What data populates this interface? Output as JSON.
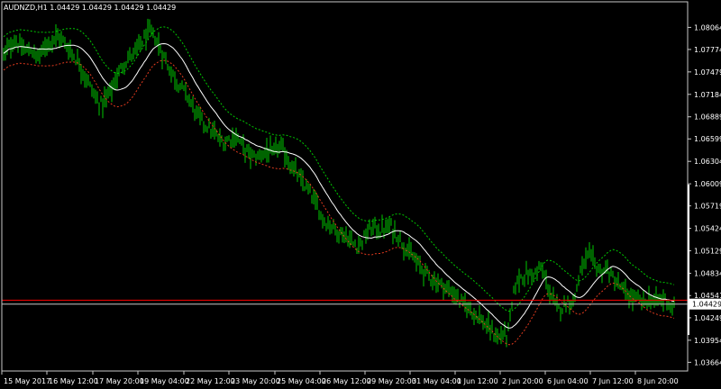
{
  "chart_data": {
    "type": "candlestick",
    "symbol_label": "AUDNZD,H1",
    "ohlc_label": "1.04429 1.04429 1.04429 1.04429",
    "current_price_label": "1.04429",
    "bid_line_price": 1.04429,
    "ask_line_price": 1.0448,
    "ylim": [
      1.0355,
      1.084
    ],
    "y_ticks": [
      "1.08064",
      "1.07774",
      "1.07479",
      "1.07184",
      "1.06889",
      "1.06599",
      "1.06304",
      "1.06009",
      "1.05719",
      "1.05424",
      "1.05129",
      "1.04834",
      "1.04541",
      "1.04249",
      "1.03954",
      "1.03664"
    ],
    "x_ticks": [
      "15 May 2017",
      "16 May 12:00",
      "17 May 20:00",
      "19 May 04:00",
      "22 May 12:00",
      "23 May 20:00",
      "25 May 04:00",
      "26 May 12:00",
      "29 May 20:00",
      "31 May 04:00",
      "1 Jun 12:00",
      "2 Jun 20:00",
      "6 Jun 04:00",
      "7 Jun 12:00",
      "8 Jun 20:00"
    ],
    "price_path": [
      [
        0,
        1.077
      ],
      [
        6,
        1.078
      ],
      [
        12,
        1.079
      ],
      [
        18,
        1.0782
      ],
      [
        24,
        1.0775
      ],
      [
        30,
        1.0778
      ],
      [
        36,
        1.0768
      ],
      [
        42,
        1.0772
      ],
      [
        48,
        1.0785
      ],
      [
        54,
        1.079
      ],
      [
        60,
        1.0795
      ],
      [
        66,
        1.0788
      ],
      [
        72,
        1.078
      ],
      [
        78,
        1.077
      ],
      [
        84,
        1.076
      ],
      [
        90,
        1.0745
      ],
      [
        96,
        1.073
      ],
      [
        102,
        1.0715
      ],
      [
        108,
        1.0705
      ],
      [
        114,
        1.0712
      ],
      [
        120,
        1.0725
      ],
      [
        126,
        1.074
      ],
      [
        132,
        1.0755
      ],
      [
        138,
        1.0765
      ],
      [
        144,
        1.077
      ],
      [
        150,
        1.078
      ],
      [
        156,
        1.079
      ],
      [
        162,
        1.08
      ],
      [
        168,
        1.0795
      ],
      [
        174,
        1.078
      ],
      [
        180,
        1.0765
      ],
      [
        186,
        1.075
      ],
      [
        192,
        1.0738
      ],
      [
        198,
        1.0728
      ],
      [
        204,
        1.0718
      ],
      [
        210,
        1.0705
      ],
      [
        216,
        1.069
      ],
      [
        222,
        1.0682
      ],
      [
        228,
        1.0675
      ],
      [
        234,
        1.0668
      ],
      [
        240,
        1.066
      ],
      [
        246,
        1.0655
      ],
      [
        252,
        1.066
      ],
      [
        258,
        1.0665
      ],
      [
        264,
        1.0655
      ],
      [
        270,
        1.0645
      ],
      [
        276,
        1.0638
      ],
      [
        282,
        1.0635
      ],
      [
        288,
        1.064
      ],
      [
        294,
        1.0645
      ],
      [
        300,
        1.0638
      ],
      [
        306,
        1.065
      ],
      [
        312,
        1.0645
      ],
      [
        318,
        1.063
      ],
      [
        324,
        1.062
      ],
      [
        330,
        1.0608
      ],
      [
        336,
        1.0598
      ],
      [
        342,
        1.0588
      ],
      [
        348,
        1.0575
      ],
      [
        354,
        1.056
      ],
      [
        360,
        1.055
      ],
      [
        366,
        1.0545
      ],
      [
        372,
        1.054
      ],
      [
        378,
        1.0535
      ],
      [
        384,
        1.053
      ],
      [
        390,
        1.0522
      ],
      [
        396,
        1.052
      ],
      [
        402,
        1.053
      ],
      [
        408,
        1.054
      ],
      [
        414,
        1.0545
      ],
      [
        420,
        1.0538
      ],
      [
        426,
        1.0542
      ],
      [
        432,
        1.0545
      ],
      [
        438,
        1.0535
      ],
      [
        444,
        1.0525
      ],
      [
        450,
        1.0515
      ],
      [
        456,
        1.0505
      ],
      [
        462,
        1.0495
      ],
      [
        468,
        1.0488
      ],
      [
        474,
        1.048
      ],
      [
        480,
        1.0475
      ],
      [
        486,
        1.047
      ],
      [
        492,
        1.0465
      ],
      [
        498,
        1.046
      ],
      [
        504,
        1.0455
      ],
      [
        510,
        1.0445
      ],
      [
        516,
        1.044
      ],
      [
        522,
        1.0435
      ],
      [
        528,
        1.043
      ],
      [
        534,
        1.042
      ],
      [
        540,
        1.0412
      ],
      [
        546,
        1.0405
      ],
      [
        552,
        1.0398
      ],
      [
        558,
        1.0405
      ],
      [
        562,
        1.04
      ],
      [
        566,
        1.043
      ],
      [
        570,
        1.0465
      ],
      [
        576,
        1.0478
      ],
      [
        582,
        1.0482
      ],
      [
        588,
        1.048
      ],
      [
        594,
        1.0485
      ],
      [
        600,
        1.049
      ],
      [
        606,
        1.047
      ],
      [
        612,
        1.045
      ],
      [
        618,
        1.0435
      ],
      [
        624,
        1.044
      ],
      [
        630,
        1.0448
      ],
      [
        636,
        1.0445
      ],
      [
        642,
        1.048
      ],
      [
        648,
        1.05
      ],
      [
        654,
        1.0505
      ],
      [
        660,
        1.0495
      ],
      [
        666,
        1.0485
      ],
      [
        672,
        1.049
      ],
      [
        678,
        1.048
      ],
      [
        684,
        1.047
      ],
      [
        690,
        1.0462
      ],
      [
        696,
        1.0455
      ],
      [
        702,
        1.045
      ],
      [
        708,
        1.0448
      ],
      [
        714,
        1.0445
      ],
      [
        720,
        1.045
      ],
      [
        726,
        1.0446
      ],
      [
        732,
        1.0448
      ],
      [
        738,
        1.045
      ],
      [
        744,
        1.044
      ],
      [
        748,
        1.0438
      ]
    ],
    "grid": false
  }
}
